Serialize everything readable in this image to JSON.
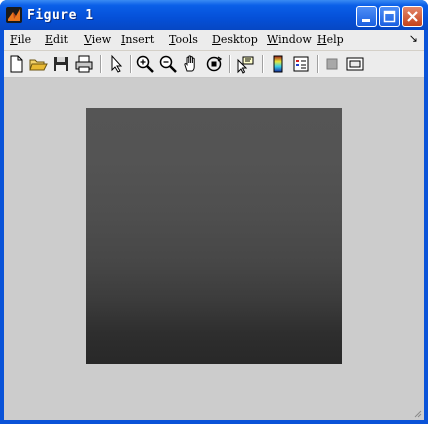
{
  "window": {
    "title": "Figure 1"
  },
  "menu": {
    "items": [
      {
        "key": "F",
        "rest": "ile"
      },
      {
        "key": "E",
        "rest": "dit"
      },
      {
        "key": "V",
        "rest": "iew"
      },
      {
        "key": "I",
        "rest": "nsert"
      },
      {
        "key": "T",
        "rest": "ools"
      },
      {
        "key": "D",
        "rest": "esktop"
      },
      {
        "key": "W",
        "rest": "indow"
      },
      {
        "key": "H",
        "rest": "elp"
      }
    ],
    "overflow": "↘"
  },
  "toolbar": {
    "tools": [
      "new-figure-icon",
      "open-file-icon",
      "save-icon",
      "print-icon",
      "edit-plot-arrow-icon",
      "zoom-in-icon",
      "zoom-out-icon",
      "pan-hand-icon",
      "rotate-3d-icon",
      "data-cursor-icon",
      "colorbar-icon",
      "legend-icon",
      "hide-plot-tools-icon",
      "show-plot-tools-icon"
    ]
  },
  "figure": {
    "background": "#cccccc",
    "image_gradient": [
      "#555555",
      "#282828"
    ]
  }
}
